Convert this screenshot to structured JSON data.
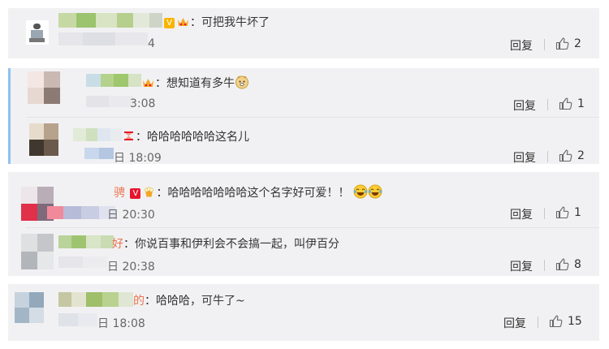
{
  "comments": [
    {
      "name_partial": "",
      "text": "：可把我牛坏了",
      "time": "4",
      "reply_label": "回复",
      "likes": "2",
      "badges": [
        "v-icon",
        "crown-icon"
      ]
    },
    {
      "name_partial": "",
      "text": "：想知道有多牛",
      "time": "3:08",
      "reply_label": "回复",
      "likes": "1",
      "badges": [
        "crown-icon"
      ]
    },
    {
      "name_partial": "",
      "text": "：哈哈哈哈哈哈这名儿",
      "time": "日 18:09",
      "reply_label": "回复",
      "likes": "2",
      "badges": [
        "hourglass-icon"
      ]
    },
    {
      "name_partial": "骋",
      "text": "：哈哈哈哈哈哈哈这个名字好可爱！！",
      "time": "日 20:30",
      "reply_label": "回复",
      "likes": "1",
      "badges": [
        "v-icon",
        "popcorn-icon"
      ]
    },
    {
      "name_partial": "好",
      "text": "：你说百事和伊利会不会搞一起，叫伊百分",
      "time": "日 20:38",
      "reply_label": "回复",
      "likes": "8",
      "badges": []
    },
    {
      "name_partial": "的",
      "text": "：哈哈哈，可牛了~",
      "time": "日 18:08",
      "reply_label": "回复",
      "likes": "15",
      "badges": []
    }
  ],
  "colors": {
    "card_bg": "#f1f1f3",
    "name_orange": "#eb7350",
    "thread_accent": "#8fc1f1",
    "vip_gold": "#f7b500"
  }
}
